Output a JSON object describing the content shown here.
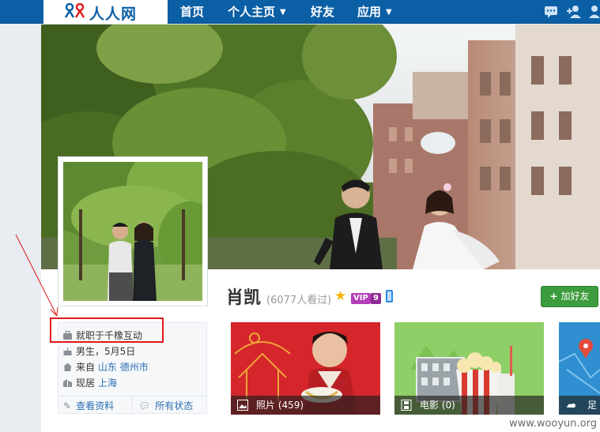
{
  "nav": {
    "logo_text": "人人网",
    "items": [
      {
        "label": "首页",
        "has_dropdown": false
      },
      {
        "label": "个人主页",
        "has_dropdown": true
      },
      {
        "label": "好友",
        "has_dropdown": false
      },
      {
        "label": "应用",
        "has_dropdown": true
      }
    ],
    "right_icons": [
      "chat-icon",
      "add-friend-icon",
      "people-icon"
    ],
    "bar_color": "#0b5fa5"
  },
  "profile": {
    "name": "肖凯",
    "views": "(6077人看过)",
    "vip_label": "VIP",
    "vip_level": "9",
    "add_friend_label": "加好友"
  },
  "info": {
    "job": "就职于千橡互动",
    "gender_birthday": "男生，5月5日",
    "from_label": "来自",
    "from_province": "山东",
    "from_city": "德州市",
    "live_label": "现居",
    "live_city": "上海",
    "view_profile": "查看资料",
    "all_status": "所有状态"
  },
  "tiles": [
    {
      "label": "照片 (459)",
      "icon": "photo-icon"
    },
    {
      "label": "电影 (0)",
      "icon": "film-icon"
    },
    {
      "label": "足迹",
      "icon": "travel-icon"
    }
  ],
  "annotation": {
    "highlight_color": "#e01919"
  },
  "watermark": "www.wooyun.org"
}
